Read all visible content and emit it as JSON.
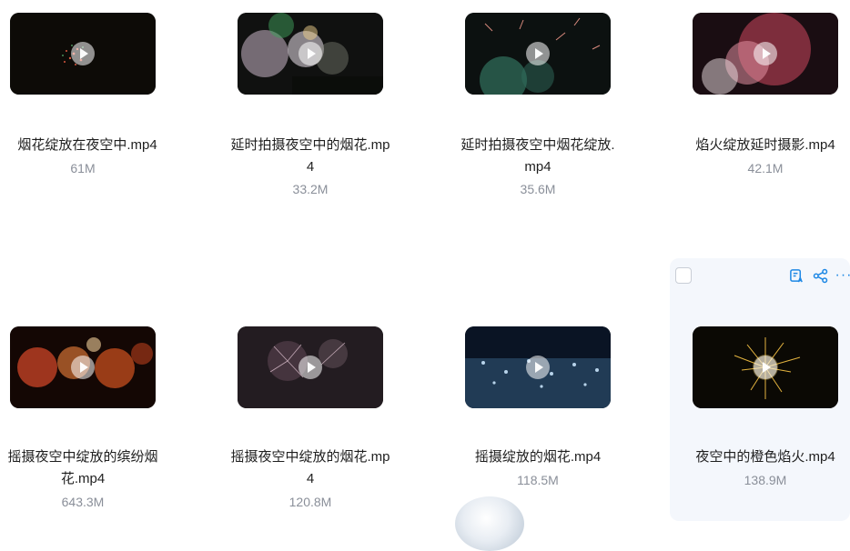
{
  "files": [
    {
      "name": "烟花绽放在夜空中.mp4",
      "size": "61M"
    },
    {
      "name": "延时拍摄夜空中的烟花.mp4",
      "size": "33.2M"
    },
    {
      "name": "延时拍摄夜空中烟花绽放.mp4",
      "size": "35.6M"
    },
    {
      "name": "焰火绽放延时摄影.mp4",
      "size": "42.1M"
    },
    {
      "name": "摇摄夜空中绽放的缤纷烟花.mp4",
      "size": "643.3M"
    },
    {
      "name": "摇摄夜空中绽放的烟花.mp4",
      "size": "120.8M"
    },
    {
      "name": "摇摄绽放的烟花.mp4",
      "size": "118.5M"
    },
    {
      "name": "夜空中的橙色焰火.mp4",
      "size": "138.9M"
    }
  ],
  "hover_actions": {
    "icons": [
      "image-ai-icon",
      "share-icon",
      "more-icon"
    ],
    "more_label": "···"
  },
  "colors": {
    "accent": "#1e88e5",
    "size_text": "#8a8f99",
    "hover_bg": "#f4f7fc"
  }
}
